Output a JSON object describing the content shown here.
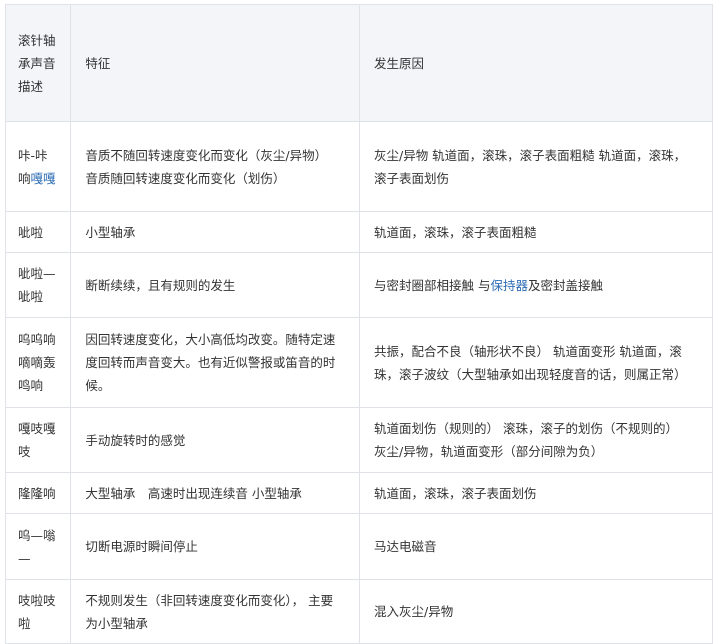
{
  "header": {
    "col1": "滚针轴承声音描述",
    "col2": "特征",
    "col3": "发生原因"
  },
  "rows": [
    {
      "sound_a": "咔-咔响",
      "sound_link": "嘎嘎",
      "feature_lines": [
        "音质不随回转速度变化而变化（灰尘/异物）",
        "音质随回转速度变化而变化（划伤）"
      ],
      "cause": "灰尘/异物 轨道面，滚珠，滚子表面粗糙 轨道面，滚珠，滚子表面划伤"
    },
    {
      "sound": "呲啦",
      "feature": "小型轴承",
      "cause": "轨道面，滚珠，滚子表面粗糙"
    },
    {
      "sound": "呲啦—呲啦",
      "feature": "断断续续，且有规则的发生",
      "cause_a": "与密封圈部相接触 与",
      "cause_link": "保持器",
      "cause_b": "及密封盖接触"
    },
    {
      "sound": "呜呜响嘀嘀轰鸣响",
      "feature": "因回转速度变化，大小高低均改变。随特定速度回转而声音变大。也有近似警报或笛音的时候。",
      "cause": "共振，配合不良（轴形状不良） 轨道面变形 轨道面，滚珠，滚子波纹（大型轴承如出现轻度音的话，则属正常）"
    },
    {
      "sound": "嘎吱嘎吱",
      "feature": "手动旋转时的感觉",
      "cause_lines": [
        "轨道面划伤（规则的） 滚珠，滚子的划伤（不规则的）",
        "灰尘/异物，轨道面变形（部分间隙为负）"
      ]
    },
    {
      "sound": "隆隆响",
      "feature": "大型轴承　高速时出现连续音 小型轴承",
      "cause": "轨道面，滚珠，滚子表面划伤"
    },
    {
      "sound": "呜—嗡—",
      "feature": "切断电源时瞬间停止",
      "cause": "马达电磁音"
    },
    {
      "sound": "吱啦吱啦",
      "feature": "不规则发生（非回转速度变化而变化）， 主要为小型轴承",
      "cause": "混入灰尘/异物"
    }
  ]
}
